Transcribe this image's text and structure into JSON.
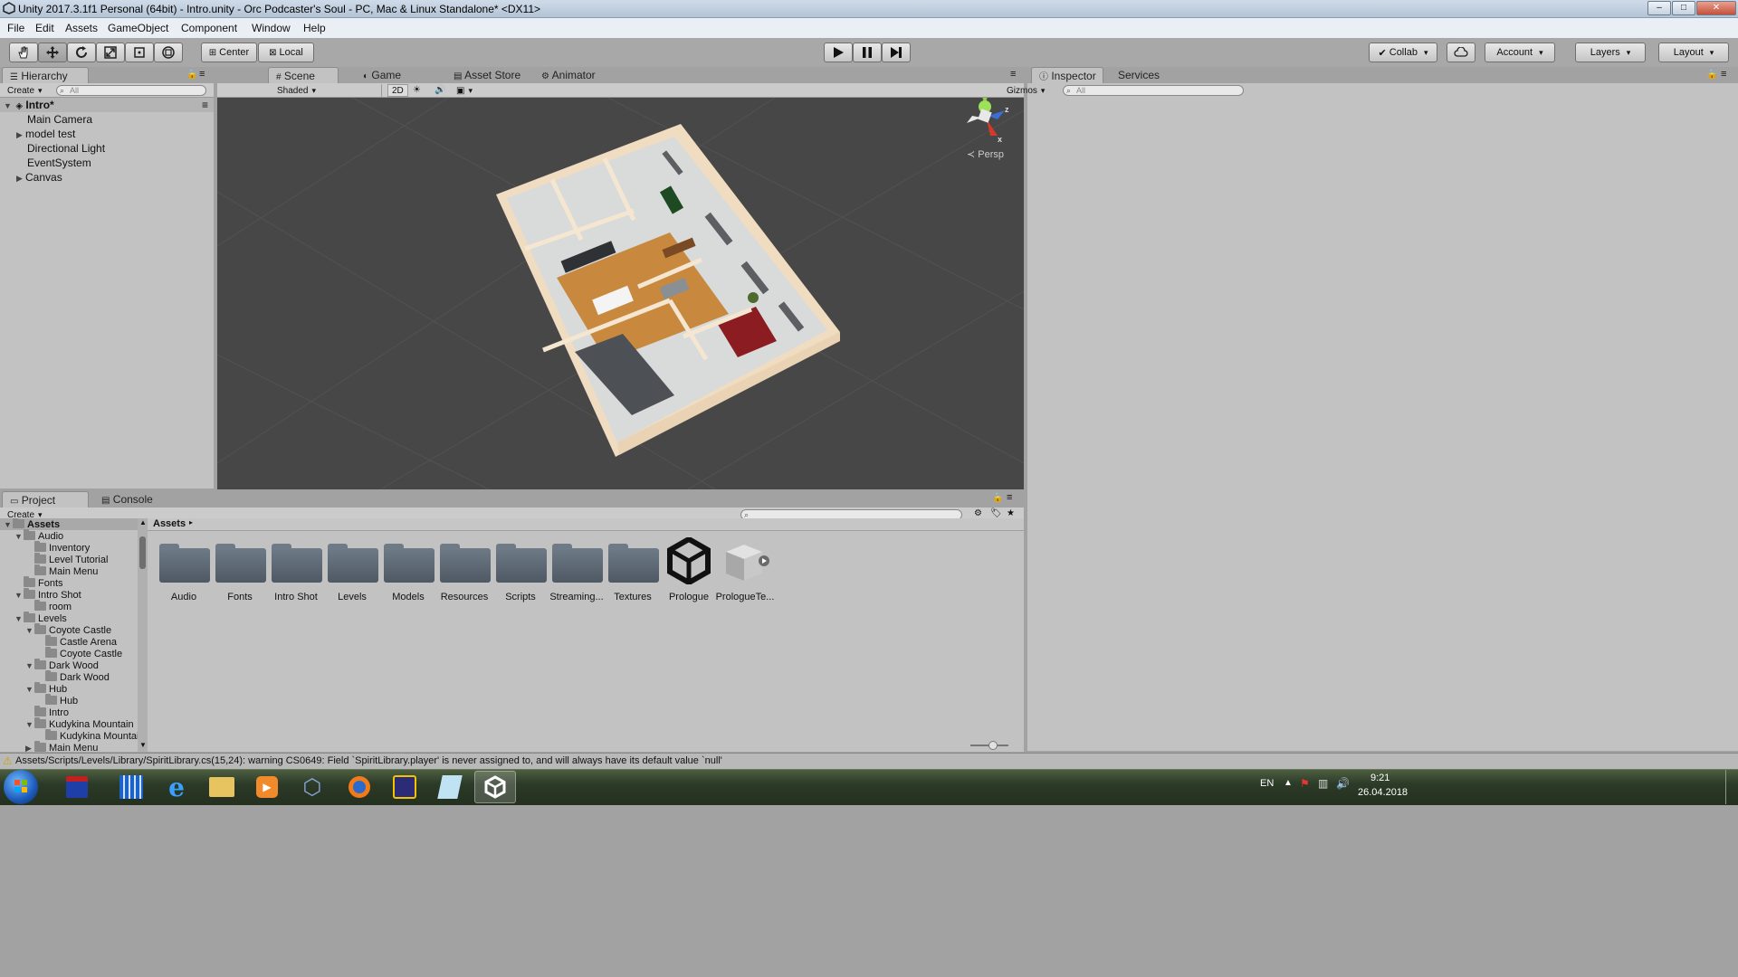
{
  "window": {
    "title": "Unity 2017.3.1f1 Personal (64bit) - Intro.unity - Orc Podcaster's Soul - PC, Mac & Linux Standalone* <DX11>",
    "controls": {
      "minimize": "‒",
      "maximize": "□",
      "close": "✕"
    }
  },
  "menu": [
    "File",
    "Edit",
    "Assets",
    "GameObject",
    "Component",
    "Window",
    "Help"
  ],
  "toolbar": {
    "pivot": "Center",
    "space": "Local",
    "collab": "Collab",
    "account": "Account",
    "layers": "Layers",
    "layout": "Layout",
    "play_icon": "play-icon",
    "pause_icon": "pause-icon",
    "step_icon": "step-icon"
  },
  "hierarchy": {
    "tab": "Hierarchy",
    "create": "Create",
    "search_placeholder": "All",
    "scene_name": "Intro*",
    "items": [
      {
        "label": "Main Camera",
        "expandable": false
      },
      {
        "label": "model test",
        "expandable": true
      },
      {
        "label": "Directional Light",
        "expandable": false
      },
      {
        "label": "EventSystem",
        "expandable": false
      },
      {
        "label": "Canvas",
        "expandable": true
      }
    ]
  },
  "center_tabs": [
    "Scene",
    "Game",
    "Asset Store",
    "Animator"
  ],
  "scene_bar": {
    "draw_mode": "Shaded",
    "two_d": "2D",
    "gizmos": "Gizmos",
    "search_placeholder": "All"
  },
  "scene_gizmo": {
    "y": "y",
    "z": "z",
    "x": "x",
    "persp": "Persp"
  },
  "inspector": {
    "tabs": [
      "Inspector",
      "Services"
    ]
  },
  "project": {
    "tabs": [
      "Project",
      "Console"
    ],
    "create": "Create",
    "breadcrumb": "Assets",
    "tree": [
      {
        "label": "Assets",
        "level": 0,
        "arrow": "down"
      },
      {
        "label": "Audio",
        "level": 1,
        "arrow": "down"
      },
      {
        "label": "Inventory",
        "level": 2,
        "arrow": ""
      },
      {
        "label": "Level Tutorial",
        "level": 2,
        "arrow": ""
      },
      {
        "label": "Main Menu",
        "level": 2,
        "arrow": ""
      },
      {
        "label": "Fonts",
        "level": 1,
        "arrow": ""
      },
      {
        "label": "Intro Shot",
        "level": 1,
        "arrow": "down"
      },
      {
        "label": "room",
        "level": 2,
        "arrow": ""
      },
      {
        "label": "Levels",
        "level": 1,
        "arrow": "down"
      },
      {
        "label": "Coyote Castle",
        "level": 2,
        "arrow": "down"
      },
      {
        "label": "Castle Arena",
        "level": 3,
        "arrow": ""
      },
      {
        "label": "Coyote Castle",
        "level": 3,
        "arrow": ""
      },
      {
        "label": "Dark Wood",
        "level": 2,
        "arrow": "down"
      },
      {
        "label": "Dark Wood",
        "level": 3,
        "arrow": ""
      },
      {
        "label": "Hub",
        "level": 2,
        "arrow": "down"
      },
      {
        "label": "Hub",
        "level": 3,
        "arrow": ""
      },
      {
        "label": "Intro",
        "level": 2,
        "arrow": ""
      },
      {
        "label": "Kudykina Mountain",
        "level": 2,
        "arrow": "down"
      },
      {
        "label": "Kudykina Mountain",
        "level": 3,
        "arrow": ""
      },
      {
        "label": "Main Menu",
        "level": 2,
        "arrow": "right"
      }
    ],
    "assets": [
      {
        "label": "Audio",
        "kind": "folder"
      },
      {
        "label": "Fonts",
        "kind": "folder"
      },
      {
        "label": "Intro Shot",
        "kind": "folder"
      },
      {
        "label": "Levels",
        "kind": "folder"
      },
      {
        "label": "Models",
        "kind": "folder"
      },
      {
        "label": "Resources",
        "kind": "folder"
      },
      {
        "label": "Scripts",
        "kind": "folder"
      },
      {
        "label": "Streaming...",
        "kind": "folder"
      },
      {
        "label": "Textures",
        "kind": "folder"
      },
      {
        "label": "Prologue",
        "kind": "unity-scene"
      },
      {
        "label": "PrologueTe...",
        "kind": "prefab"
      }
    ]
  },
  "status": {
    "message": "Assets/Scripts/Levels/Library/SpiritLibrary.cs(15,24): warning CS0649: Field `SpiritLibrary.player' is never assigned to, and will always have its default value `null'",
    "icon": "warning-icon"
  },
  "taskbar": {
    "apps": [
      "save-app",
      "calculator-app",
      "internet-explorer",
      "file-explorer",
      "media-player",
      "virtualbox",
      "blender",
      "game-maker",
      "notepad",
      "unity"
    ],
    "lang": "EN",
    "time": "9:21",
    "date": "26.04.2018"
  },
  "colors": {
    "panel": "#c2c2c2",
    "scene_bg": "#474747",
    "selected_row": "#3d80df",
    "floor_wood": "#c8893f",
    "sofa": "#8b1d22"
  }
}
